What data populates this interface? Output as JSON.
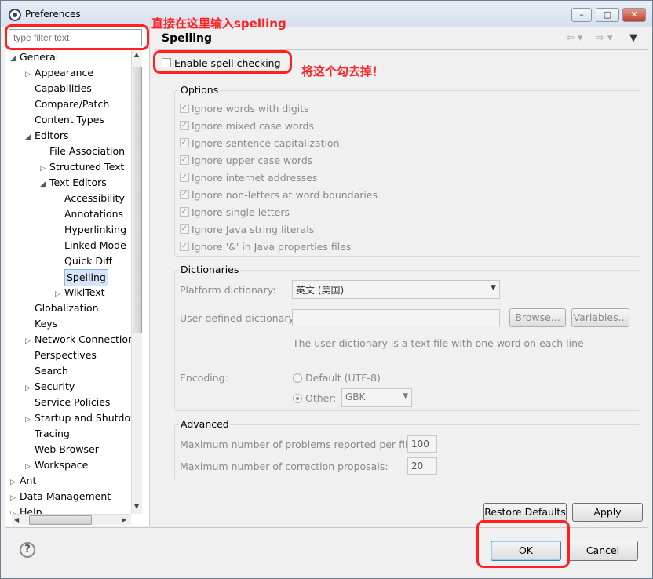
{
  "window": {
    "title": "Preferences"
  },
  "filter": {
    "placeholder": "type filter text"
  },
  "tree": [
    {
      "label": "General",
      "expanded": true
    },
    {
      "label": "Appearance"
    },
    {
      "label": "Capabilities"
    },
    {
      "label": "Compare/Patch"
    },
    {
      "label": "Content Types"
    },
    {
      "label": "Editors",
      "expanded": true
    },
    {
      "label": "File Association"
    },
    {
      "label": "Structured Text"
    },
    {
      "label": "Text Editors",
      "expanded": true
    },
    {
      "label": "Accessibility"
    },
    {
      "label": "Annotations"
    },
    {
      "label": "Hyperlinking"
    },
    {
      "label": "Linked Mode"
    },
    {
      "label": "Quick Diff"
    },
    {
      "label": "Spelling",
      "selected": true
    },
    {
      "label": "WikiText"
    },
    {
      "label": "Globalization"
    },
    {
      "label": "Keys"
    },
    {
      "label": "Network Connection"
    },
    {
      "label": "Perspectives"
    },
    {
      "label": "Search"
    },
    {
      "label": "Security"
    },
    {
      "label": "Service Policies"
    },
    {
      "label": "Startup and Shutdown"
    },
    {
      "label": "Tracing"
    },
    {
      "label": "Web Browser"
    },
    {
      "label": "Workspace"
    },
    {
      "label": "Ant"
    },
    {
      "label": "Data Management"
    },
    {
      "label": "Help"
    }
  ],
  "page": {
    "title": "Spelling"
  },
  "enable_spell": {
    "label": "Enable spell checking",
    "checked": false
  },
  "annotations": {
    "filter_note": "直接在这里输入spelling",
    "checkbox_note": "将这个勾去掉！"
  },
  "options": {
    "title": "Options",
    "items": [
      "Ignore words with digits",
      "Ignore mixed case words",
      "Ignore sentence capitalization",
      "Ignore upper case words",
      "Ignore internet addresses",
      "Ignore non-letters at word boundaries",
      "Ignore single letters",
      "Ignore Java string literals",
      "Ignore '&' in Java properties files"
    ]
  },
  "dictionaries": {
    "title": "Dictionaries",
    "platform_label": "Platform dictionary:",
    "platform_value": "英文 (美国)",
    "user_label": "User defined dictionary:",
    "browse_label": "Browse...",
    "variables_label": "Variables...",
    "note": "The user dictionary is a text file with one word on each line",
    "encoding_label": "Encoding:",
    "default_label": "Default (UTF-8)",
    "other_label": "Other:",
    "other_value": "GBK"
  },
  "advanced": {
    "title": "Advanced",
    "max_problems_label": "Maximum number of problems reported per file:",
    "max_problems_value": "100",
    "max_proposals_label": "Maximum number of correction proposals:",
    "max_proposals_value": "20"
  },
  "buttons": {
    "restore": "Restore Defaults",
    "apply": "Apply",
    "ok": "OK",
    "cancel": "Cancel"
  },
  "colors": {
    "annotation": "#ff2020",
    "selection": "#d5e4f7"
  }
}
